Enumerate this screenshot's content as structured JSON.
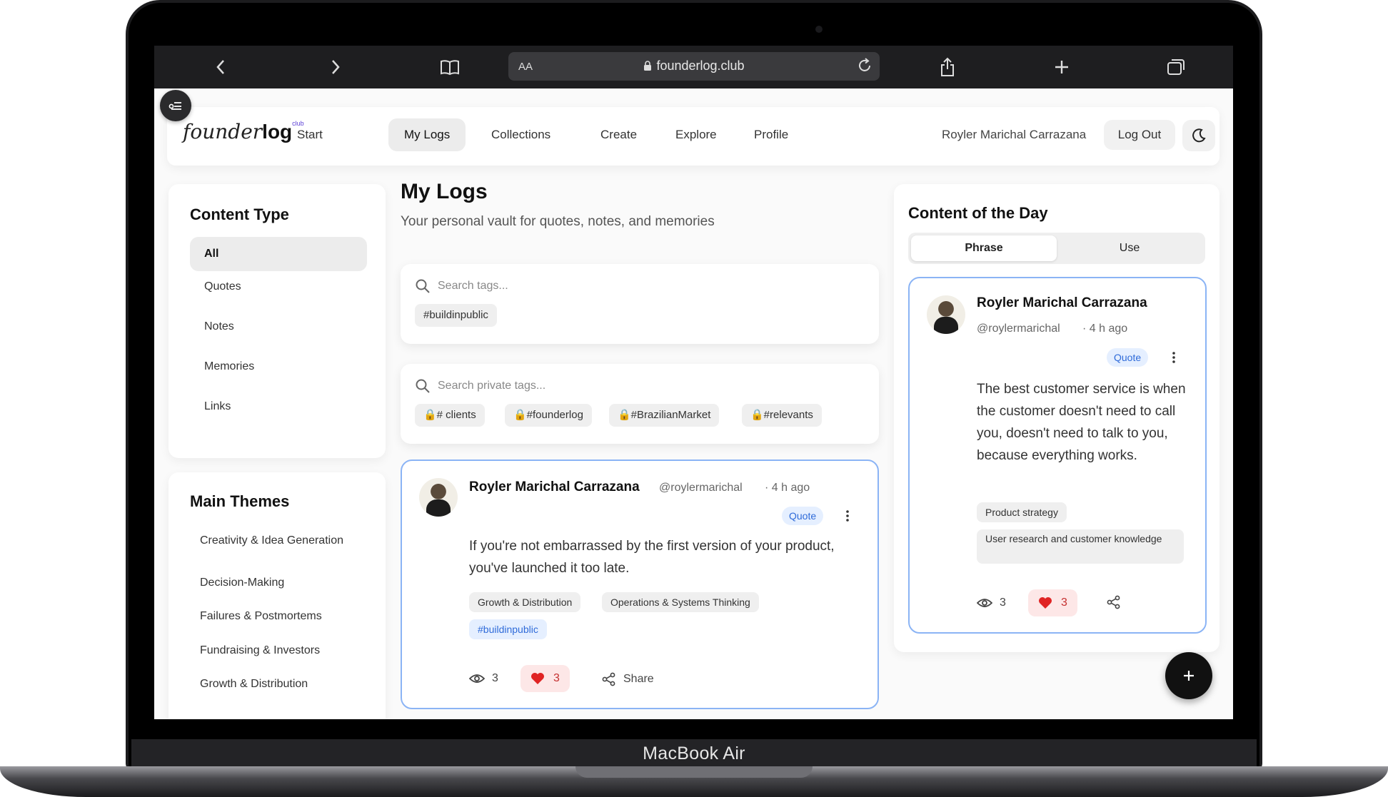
{
  "device": {
    "label": "MacBook Air"
  },
  "browser": {
    "aa": "AA",
    "url": "founderlog.club"
  },
  "nav": {
    "logo_main": "founder",
    "logo_bold": "log",
    "logo_small": "club",
    "items": [
      {
        "label": "Start",
        "active": false
      },
      {
        "label": "My Logs",
        "active": true
      },
      {
        "label": "Collections",
        "active": false
      },
      {
        "label": "Create",
        "active": false
      },
      {
        "label": "Explore",
        "active": false
      },
      {
        "label": "Profile",
        "active": false
      }
    ],
    "user_name": "Royler Marichal Carrazana",
    "logout": "Log Out"
  },
  "sidebar": {
    "content_type_title": "Content Type",
    "content_types": [
      "All",
      "Quotes",
      "Notes",
      "Memories",
      "Links"
    ],
    "themes_title": "Main Themes",
    "themes": [
      "Creativity & Idea Generation",
      "Decision-Making",
      "Failures & Postmortems",
      "Fundraising & Investors",
      "Growth & Distribution"
    ]
  },
  "main": {
    "title": "My Logs",
    "subtitle": "Your personal vault for quotes, notes, and memories",
    "public_search": {
      "placeholder": "Search tags...",
      "tags": [
        "#buildinpublic"
      ]
    },
    "private_search": {
      "placeholder": "Search private tags...",
      "tags": [
        "🔒# clients",
        "🔒#founderlog",
        "🔒#BrazilianMarket",
        "🔒#relevants"
      ]
    },
    "post": {
      "author": "Royler Marichal Carrazana",
      "handle": "@roylermarichal",
      "time": "· 4 h ago",
      "badge": "Quote",
      "text": "If you're not embarrassed by the first version of your product, you've launched it too late.",
      "tags": [
        "Growth & Distribution",
        "Operations & Systems Thinking"
      ],
      "hashtag": "#buildinpublic",
      "views": "3",
      "likes": "3",
      "share": "Share"
    }
  },
  "content_of_day": {
    "title": "Content of the Day",
    "tabs": [
      "Phrase",
      "Use"
    ],
    "post": {
      "author": "Royler Marichal Carrazana",
      "handle": "@roylermarichal",
      "time": "· 4 h ago",
      "badge": "Quote",
      "text": "The best customer service is when the customer doesn't need to call you, doesn't need to talk to you, because everything works.",
      "tags": [
        "Product strategy",
        "User research and customer knowledge"
      ],
      "views": "3",
      "likes": "3"
    }
  },
  "colors": {
    "accent_border": "#8bb4f5",
    "badge_text": "#2f6bd9",
    "heart": "#e02424"
  }
}
